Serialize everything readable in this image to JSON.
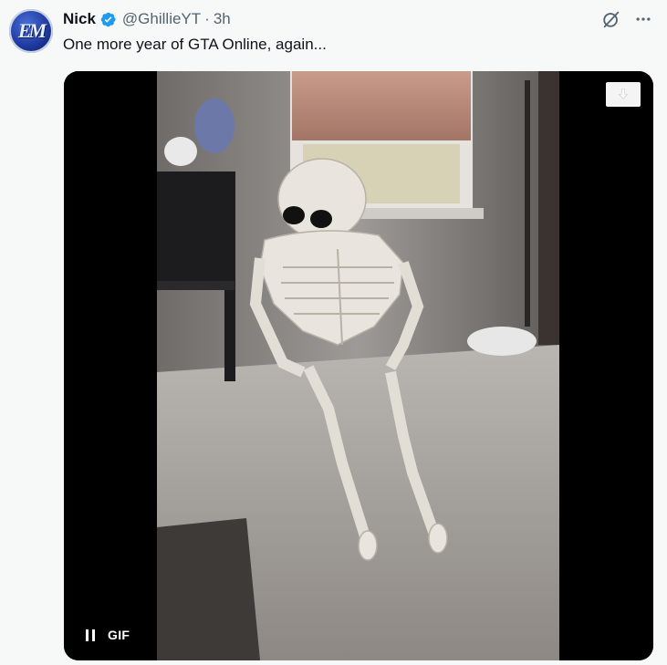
{
  "author": {
    "avatar_text": "EM",
    "name": "Nick",
    "verified": true,
    "handle": "@GhillieYT",
    "separator": "·",
    "time": "3h"
  },
  "tweet": {
    "text": "One more year of GTA Online, again..."
  },
  "media": {
    "type": "GIF",
    "badge_label": "GIF",
    "playing": true,
    "description": "skeleton"
  },
  "actions": {
    "grok_icon": "grok-icon",
    "more_icon": "more-icon",
    "download_icon": "download-icon",
    "pause_icon": "pause-icon"
  },
  "colors": {
    "background": "#f7f9f9",
    "text_primary": "#0f1419",
    "text_secondary": "#536471",
    "verified_blue": "#1d9bf0"
  }
}
